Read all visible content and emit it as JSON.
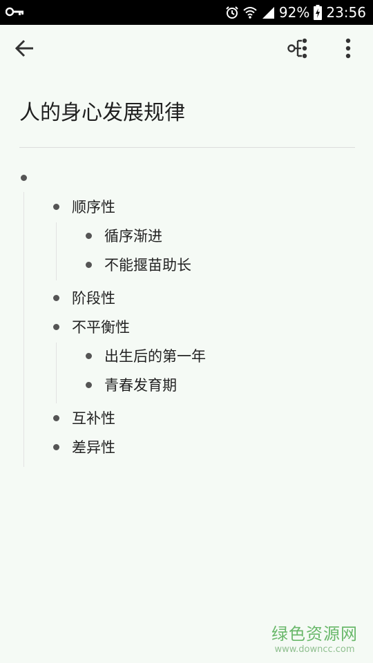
{
  "status_bar": {
    "battery": "92%",
    "time": "23:56",
    "icons": [
      "key-icon",
      "alarm-icon",
      "wifi-icon",
      "signal-icon",
      "battery-icon"
    ]
  },
  "toolbar": {
    "icons": [
      "back-arrow-icon",
      "mindmap-icon",
      "more-vertical-icon"
    ]
  },
  "document": {
    "title": "人的身心发展规律",
    "root": {
      "label": "",
      "children": [
        {
          "label": "顺序性",
          "children": [
            {
              "label": "循序渐进"
            },
            {
              "label": "不能揠苗助长"
            }
          ]
        },
        {
          "label": "阶段性"
        },
        {
          "label": "不平衡性",
          "children": [
            {
              "label": "出生后的第一年"
            },
            {
              "label": "青春发育期"
            }
          ]
        },
        {
          "label": "互补性"
        },
        {
          "label": "差异性"
        }
      ]
    }
  },
  "watermark": {
    "cn": "绿色资源网",
    "en": "www.downcc.com"
  },
  "colors": {
    "background": "#f5faf5",
    "status_bar": "#000000",
    "bullet": "#555555",
    "watermark": "#69b86a"
  }
}
